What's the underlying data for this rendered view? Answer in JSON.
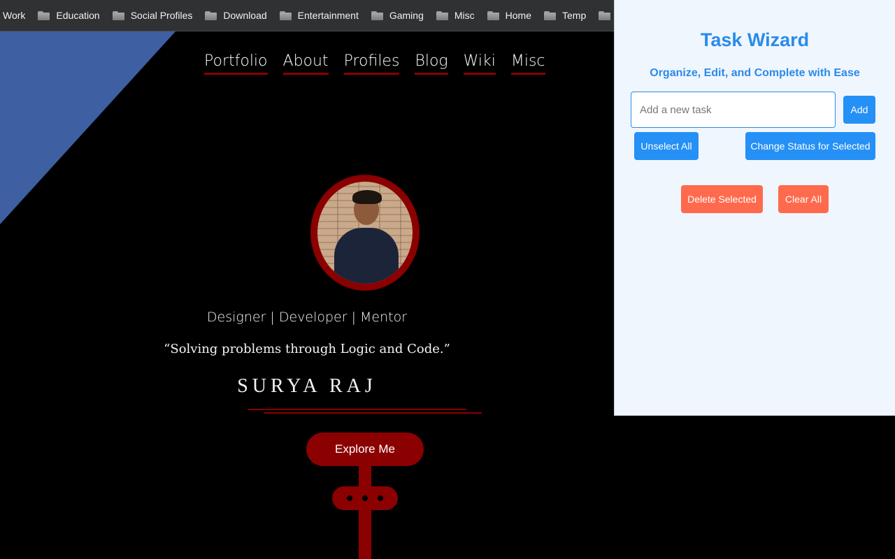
{
  "bookmarks": [
    {
      "label": "Work",
      "icon": "folder-icon",
      "has_icon": false
    },
    {
      "label": "Education",
      "icon": "folder-icon",
      "has_icon": true
    },
    {
      "label": "Social Profiles",
      "icon": "folder-icon",
      "has_icon": true
    },
    {
      "label": "Download",
      "icon": "folder-icon",
      "has_icon": true
    },
    {
      "label": "Entertainment",
      "icon": "folder-icon",
      "has_icon": true
    },
    {
      "label": "Gaming",
      "icon": "folder-icon",
      "has_icon": true
    },
    {
      "label": "Misc",
      "icon": "folder-icon",
      "has_icon": true
    },
    {
      "label": "Home",
      "icon": "folder-icon",
      "has_icon": true
    },
    {
      "label": "Temp",
      "icon": "folder-icon",
      "has_icon": true
    }
  ],
  "site": {
    "nav": [
      "Portfolio",
      "About",
      "Profiles",
      "Blog",
      "Wiki",
      "Misc"
    ],
    "tagline": "Designer | Developer | Mentor",
    "quote": "“Solving problems through Logic and Code.”",
    "name": "SURYA RAJ",
    "cta": "Explore Me",
    "colors": {
      "accent": "#8b0000",
      "diagonal": "#3f5fa3",
      "background": "#000000"
    }
  },
  "popup": {
    "title": "Task Wizard",
    "subtitle": "Organize, Edit, and Complete with Ease",
    "input_placeholder": "Add a new task",
    "input_value": "",
    "add_label": "Add",
    "unselect_label": "Unselect All",
    "change_status_label": "Change Status for Selected",
    "delete_label": "Delete Selected",
    "clear_label": "Clear All",
    "colors": {
      "primary": "#2590f5",
      "danger": "#ff6a4d",
      "background": "#f0f6fe"
    }
  }
}
